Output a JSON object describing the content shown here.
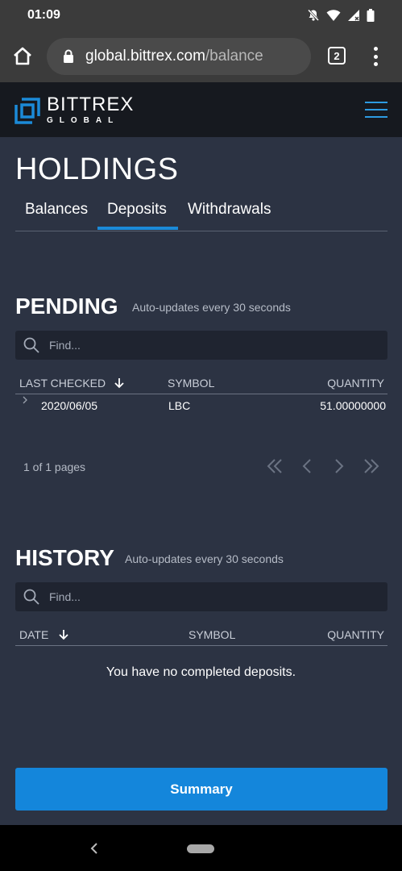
{
  "status_bar": {
    "time": "01:09"
  },
  "browser": {
    "url_host": "global.bittrex.com",
    "url_path": "/balance",
    "tab_count": "2"
  },
  "header": {
    "logo_main": "BITTREX",
    "logo_sub": "GLOBAL"
  },
  "page": {
    "title": "HOLDINGS",
    "tabs": [
      {
        "label": "Balances"
      },
      {
        "label": "Deposits",
        "active": true
      },
      {
        "label": "Withdrawals"
      }
    ]
  },
  "pending": {
    "title": "PENDING",
    "subtitle": "Auto-updates every 30 seconds",
    "search_placeholder": "Find...",
    "columns": [
      "LAST CHECKED",
      "SYMBOL",
      "QUANTITY"
    ],
    "rows": [
      {
        "date": "2020/06/05",
        "symbol": "LBC",
        "quantity": "51.00000000"
      }
    ],
    "pager": "1 of 1 pages"
  },
  "history": {
    "title": "HISTORY",
    "subtitle": "Auto-updates every 30 seconds",
    "search_placeholder": "Find...",
    "columns": [
      "DATE",
      "SYMBOL",
      "QUANTITY"
    ],
    "empty_message": "You have no completed deposits."
  },
  "summary_button": "Summary",
  "colors": {
    "accent": "#1486db",
    "background": "#2c3343",
    "header": "#16191f"
  }
}
